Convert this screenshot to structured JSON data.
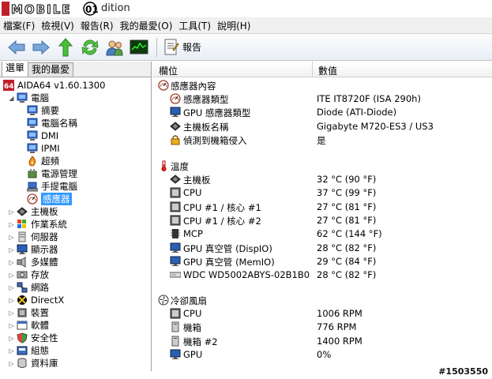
{
  "window": {
    "brand": "MOBILE01",
    "title_suffix": "dition"
  },
  "menu": [
    "檔案(F)",
    "檢視(V)",
    "報告(R)",
    "我的最愛(O)",
    "工具(T)",
    "說明(H)"
  ],
  "toolbar": {
    "report_label": "報告"
  },
  "tabs": [
    "選單",
    "我的最愛"
  ],
  "tree": [
    {
      "label": "AIDA64 v1.60.1300",
      "icon": "aida64-icon",
      "indent": 0,
      "exp": ""
    },
    {
      "label": "電腦",
      "icon": "computer-icon",
      "indent": 1,
      "exp": "◢"
    },
    {
      "label": "摘要",
      "icon": "computer-icon",
      "indent": 2,
      "exp": ""
    },
    {
      "label": "電腦名稱",
      "icon": "computer-icon",
      "indent": 2,
      "exp": ""
    },
    {
      "label": "DMI",
      "icon": "computer-icon",
      "indent": 2,
      "exp": ""
    },
    {
      "label": "IPMI",
      "icon": "computer-icon",
      "indent": 2,
      "exp": ""
    },
    {
      "label": "超頻",
      "icon": "flame-icon",
      "indent": 2,
      "exp": ""
    },
    {
      "label": "電源管理",
      "icon": "power-icon",
      "indent": 2,
      "exp": ""
    },
    {
      "label": "手提電腦",
      "icon": "laptop-icon",
      "indent": 2,
      "exp": ""
    },
    {
      "label": "感應器",
      "icon": "sensor-icon",
      "indent": 2,
      "exp": "",
      "selected": true
    },
    {
      "label": "主機板",
      "icon": "motherboard-icon",
      "indent": 1,
      "exp": "▷"
    },
    {
      "label": "作業系統",
      "icon": "windows-icon",
      "indent": 1,
      "exp": "▷"
    },
    {
      "label": "伺服器",
      "icon": "server-icon",
      "indent": 1,
      "exp": "▷"
    },
    {
      "label": "顯示器",
      "icon": "display-icon",
      "indent": 1,
      "exp": "▷"
    },
    {
      "label": "多媒體",
      "icon": "multimedia-icon",
      "indent": 1,
      "exp": "▷"
    },
    {
      "label": "存放",
      "icon": "storage-icon",
      "indent": 1,
      "exp": "▷"
    },
    {
      "label": "網路",
      "icon": "network-icon",
      "indent": 1,
      "exp": "▷"
    },
    {
      "label": "DirectX",
      "icon": "directx-icon",
      "indent": 1,
      "exp": "▷"
    },
    {
      "label": "裝置",
      "icon": "device-icon",
      "indent": 1,
      "exp": "▷"
    },
    {
      "label": "軟體",
      "icon": "software-icon",
      "indent": 1,
      "exp": "▷"
    },
    {
      "label": "安全性",
      "icon": "security-icon",
      "indent": 1,
      "exp": "▷"
    },
    {
      "label": "組態",
      "icon": "config-icon",
      "indent": 1,
      "exp": "▷"
    },
    {
      "label": "資料庫",
      "icon": "database-icon",
      "indent": 1,
      "exp": "▷"
    }
  ],
  "columns": {
    "field": "欄位",
    "value": "數值"
  },
  "sections": {
    "sensor_props": "感應器內容",
    "temperature": "溫度",
    "cooling": "冷卻風扇"
  },
  "rows": [
    {
      "field": "感應器類型",
      "value": "ITE IT8720F  (ISA 290h)",
      "icon": "sensor-icon"
    },
    {
      "field": "GPU 感應器類型",
      "value": "Diode  (ATI-Diode)",
      "icon": "display-icon"
    },
    {
      "field": "主機板名稱",
      "value": "Gigabyte M720-ES3 / US3",
      "icon": "motherboard-icon"
    },
    {
      "field": "偵測到機箱侵入",
      "value": "是",
      "icon": "lock-icon"
    },
    {
      "field": "主機板",
      "value": "32 °C  (90 °F)",
      "icon": "motherboard-icon"
    },
    {
      "field": "CPU",
      "value": "37 °C  (99 °F)",
      "icon": "cpu-icon"
    },
    {
      "field": "CPU #1 / 核心 #1",
      "value": "27 °C  (81 °F)",
      "icon": "cpu-icon"
    },
    {
      "field": "CPU #1 / 核心 #2",
      "value": "27 °C  (81 °F)",
      "icon": "cpu-icon"
    },
    {
      "field": "MCP",
      "value": "62 °C  (144 °F)",
      "icon": "chip-icon"
    },
    {
      "field": "GPU 真空管 (DispIO)",
      "value": "28 °C  (82 °F)",
      "icon": "display-icon"
    },
    {
      "field": "GPU 真空管 (MemIO)",
      "value": "29 °C  (84 °F)",
      "icon": "display-icon"
    },
    {
      "field": "WDC WD5002ABYS-02B1B0",
      "value": "28 °C  (82 °F)",
      "icon": "hdd-icon"
    },
    {
      "field": "CPU",
      "value": "1006 RPM",
      "icon": "cpu-icon"
    },
    {
      "field": "機箱",
      "value": "776 RPM",
      "icon": "case-icon"
    },
    {
      "field": "機箱 #2",
      "value": "1400 RPM",
      "icon": "case-icon"
    },
    {
      "field": "GPU",
      "value": "0%",
      "icon": "display-icon"
    }
  ],
  "footer": {
    "id": "#1503550"
  }
}
